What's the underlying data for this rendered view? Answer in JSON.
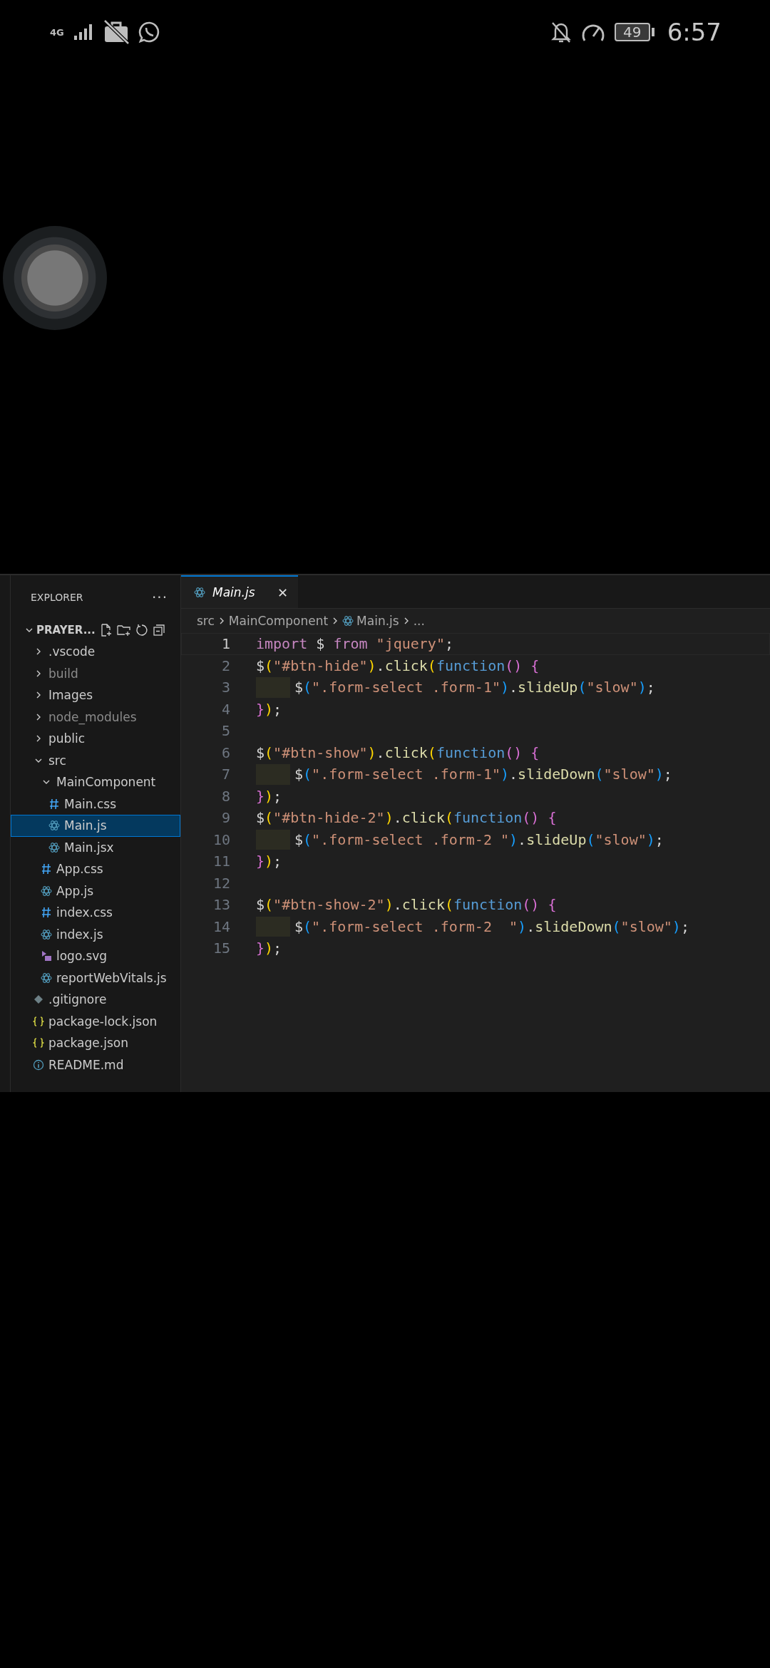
{
  "status_bar": {
    "network": "4G",
    "battery": "49",
    "time": "6:57"
  },
  "explorer": {
    "title": "EXPLORER",
    "more": "···",
    "root": {
      "label": "PRAYER...",
      "expanded": true
    },
    "items": [
      {
        "label": ".vscode",
        "kind": "folder",
        "expanded": false,
        "dimmed": false,
        "selected": false
      },
      {
        "label": "build",
        "kind": "folder",
        "expanded": false,
        "dimmed": true,
        "selected": false
      },
      {
        "label": "Images",
        "kind": "folder",
        "expanded": false,
        "dimmed": false,
        "selected": false
      },
      {
        "label": "node_modules",
        "kind": "folder",
        "expanded": false,
        "dimmed": true,
        "selected": false
      },
      {
        "label": "public",
        "kind": "folder",
        "expanded": false,
        "dimmed": false,
        "selected": false
      },
      {
        "label": "src",
        "kind": "folder",
        "expanded": true,
        "dimmed": false,
        "selected": false,
        "children": [
          {
            "label": "MainComponent",
            "kind": "folder",
            "expanded": true,
            "dimmed": false,
            "selected": false,
            "children": [
              {
                "label": "Main.css",
                "kind": "css",
                "dimmed": false,
                "selected": false
              },
              {
                "label": "Main.js",
                "kind": "js",
                "dimmed": false,
                "selected": true
              },
              {
                "label": "Main.jsx",
                "kind": "js",
                "dimmed": false,
                "selected": false
              }
            ]
          },
          {
            "label": "App.css",
            "kind": "css",
            "dimmed": false,
            "selected": false
          },
          {
            "label": "App.js",
            "kind": "js",
            "dimmed": false,
            "selected": false
          },
          {
            "label": "index.css",
            "kind": "css",
            "dimmed": false,
            "selected": false
          },
          {
            "label": "index.js",
            "kind": "js",
            "dimmed": false,
            "selected": false
          },
          {
            "label": "logo.svg",
            "kind": "svg",
            "dimmed": false,
            "selected": false
          },
          {
            "label": "reportWebVitals.js",
            "kind": "js",
            "dimmed": false,
            "selected": false
          }
        ]
      },
      {
        "label": ".gitignore",
        "kind": "git",
        "dimmed": false,
        "selected": false
      },
      {
        "label": "package-lock.json",
        "kind": "json",
        "dimmed": false,
        "selected": false
      },
      {
        "label": "package.json",
        "kind": "json",
        "dimmed": false,
        "selected": false
      },
      {
        "label": "README.md",
        "kind": "info",
        "dimmed": false,
        "selected": false
      }
    ]
  },
  "tabs": [
    {
      "label": "Main.js",
      "selected": true,
      "close": "✕"
    }
  ],
  "breadcrumb": [
    {
      "label": "src",
      "kind": "text"
    },
    {
      "label": "MainComponent",
      "kind": "text"
    },
    {
      "label": "Main.js",
      "kind": "js"
    },
    {
      "label": "...",
      "kind": "text"
    }
  ],
  "code_lines": [
    {
      "number": "1",
      "current": true,
      "indented": false,
      "tokens": [
        {
          "text": "import",
          "kind": "keyword"
        },
        {
          "text": " $ ",
          "kind": "plain"
        },
        {
          "text": "from",
          "kind": "keyword"
        },
        {
          "text": " \"jquery\"",
          "kind": "string"
        },
        {
          "text": ";",
          "kind": "plain"
        }
      ]
    },
    {
      "number": "2",
      "current": false,
      "indented": false,
      "tokens": [
        {
          "text": "$",
          "kind": "plain"
        },
        {
          "text": "(",
          "kind": "bracket1"
        },
        {
          "text": "\"#btn-hide\"",
          "kind": "string"
        },
        {
          "text": ")",
          "kind": "bracket1"
        },
        {
          "text": ".",
          "kind": "plain"
        },
        {
          "text": "click",
          "kind": "method"
        },
        {
          "text": "(",
          "kind": "bracket1"
        },
        {
          "text": "function",
          "kind": "storage"
        },
        {
          "text": "() {",
          "kind": "bracket2"
        }
      ]
    },
    {
      "number": "3",
      "current": false,
      "indented": true,
      "tokens": [
        {
          "text": "$",
          "kind": "plain"
        },
        {
          "text": "(",
          "kind": "bracket3"
        },
        {
          "text": "\".form-select .form-1\"",
          "kind": "string"
        },
        {
          "text": ")",
          "kind": "bracket3"
        },
        {
          "text": ".",
          "kind": "plain"
        },
        {
          "text": "slideUp",
          "kind": "method"
        },
        {
          "text": "(",
          "kind": "bracket3"
        },
        {
          "text": "\"slow\"",
          "kind": "string"
        },
        {
          "text": ")",
          "kind": "bracket3"
        },
        {
          "text": ";",
          "kind": "plain"
        }
      ]
    },
    {
      "number": "4",
      "current": false,
      "indented": false,
      "tokens": [
        {
          "text": "}",
          "kind": "bracket2"
        },
        {
          "text": ")",
          "kind": "bracket1"
        },
        {
          "text": ";",
          "kind": "plain"
        }
      ]
    },
    {
      "number": "5",
      "current": false,
      "indented": false
    },
    {
      "number": "6",
      "current": false,
      "indented": false,
      "tokens": [
        {
          "text": "$",
          "kind": "plain"
        },
        {
          "text": "(",
          "kind": "bracket1"
        },
        {
          "text": "\"#btn-show\"",
          "kind": "string"
        },
        {
          "text": ")",
          "kind": "bracket1"
        },
        {
          "text": ".",
          "kind": "plain"
        },
        {
          "text": "click",
          "kind": "method"
        },
        {
          "text": "(",
          "kind": "bracket1"
        },
        {
          "text": "function",
          "kind": "storage"
        },
        {
          "text": "() {",
          "kind": "bracket2"
        }
      ]
    },
    {
      "number": "7",
      "current": false,
      "indented": true,
      "tokens": [
        {
          "text": "$",
          "kind": "plain"
        },
        {
          "text": "(",
          "kind": "bracket3"
        },
        {
          "text": "\".form-select .form-1\"",
          "kind": "string"
        },
        {
          "text": ")",
          "kind": "bracket3"
        },
        {
          "text": ".",
          "kind": "plain"
        },
        {
          "text": "slideDown",
          "kind": "method"
        },
        {
          "text": "(",
          "kind": "bracket3"
        },
        {
          "text": "\"slow\"",
          "kind": "string"
        },
        {
          "text": ")",
          "kind": "bracket3"
        },
        {
          "text": ";",
          "kind": "plain"
        }
      ]
    },
    {
      "number": "8",
      "current": false,
      "indented": false,
      "tokens": [
        {
          "text": "}",
          "kind": "bracket2"
        },
        {
          "text": ")",
          "kind": "bracket1"
        },
        {
          "text": ";",
          "kind": "plain"
        }
      ]
    },
    {
      "number": "9",
      "current": false,
      "indented": false,
      "tokens": [
        {
          "text": "$",
          "kind": "plain"
        },
        {
          "text": "(",
          "kind": "bracket1"
        },
        {
          "text": "\"#btn-hide-2\"",
          "kind": "string"
        },
        {
          "text": ")",
          "kind": "bracket1"
        },
        {
          "text": ".",
          "kind": "plain"
        },
        {
          "text": "click",
          "kind": "method"
        },
        {
          "text": "(",
          "kind": "bracket1"
        },
        {
          "text": "function",
          "kind": "storage"
        },
        {
          "text": "() {",
          "kind": "bracket2"
        }
      ]
    },
    {
      "number": "10",
      "current": false,
      "indented": true,
      "tokens": [
        {
          "text": "$",
          "kind": "plain"
        },
        {
          "text": "(",
          "kind": "bracket3"
        },
        {
          "text": "\".form-select .form-2 \"",
          "kind": "string"
        },
        {
          "text": ")",
          "kind": "bracket3"
        },
        {
          "text": ".",
          "kind": "plain"
        },
        {
          "text": "slideUp",
          "kind": "method"
        },
        {
          "text": "(",
          "kind": "bracket3"
        },
        {
          "text": "\"slow\"",
          "kind": "string"
        },
        {
          "text": ")",
          "kind": "bracket3"
        },
        {
          "text": ";",
          "kind": "plain"
        }
      ]
    },
    {
      "number": "11",
      "current": false,
      "indented": false,
      "tokens": [
        {
          "text": "}",
          "kind": "bracket2"
        },
        {
          "text": ")",
          "kind": "bracket1"
        },
        {
          "text": ";",
          "kind": "plain"
        }
      ]
    },
    {
      "number": "12",
      "current": false,
      "indented": false
    },
    {
      "number": "13",
      "current": false,
      "indented": false,
      "tokens": [
        {
          "text": "$",
          "kind": "plain"
        },
        {
          "text": "(",
          "kind": "bracket1"
        },
        {
          "text": "\"#btn-show-2\"",
          "kind": "string"
        },
        {
          "text": ")",
          "kind": "bracket1"
        },
        {
          "text": ".",
          "kind": "plain"
        },
        {
          "text": "click",
          "kind": "method"
        },
        {
          "text": "(",
          "kind": "bracket1"
        },
        {
          "text": "function",
          "kind": "storage"
        },
        {
          "text": "() {",
          "kind": "bracket2"
        }
      ]
    },
    {
      "number": "14",
      "current": false,
      "indented": true,
      "tokens": [
        {
          "text": "$",
          "kind": "plain"
        },
        {
          "text": "(",
          "kind": "bracket3"
        },
        {
          "text": "\".form-select .form-2  \"",
          "kind": "string"
        },
        {
          "text": ")",
          "kind": "bracket3"
        },
        {
          "text": ".",
          "kind": "plain"
        },
        {
          "text": "slideDown",
          "kind": "method"
        },
        {
          "text": "(",
          "kind": "bracket3"
        },
        {
          "text": "\"slow\"",
          "kind": "string"
        },
        {
          "text": ")",
          "kind": "bracket3"
        },
        {
          "text": ";",
          "kind": "plain"
        }
      ]
    },
    {
      "number": "15",
      "current": false,
      "indented": false,
      "tokens": [
        {
          "text": "}",
          "kind": "bracket2"
        },
        {
          "text": ")",
          "kind": "bracket1"
        },
        {
          "text": ";",
          "kind": "plain"
        }
      ]
    }
  ]
}
